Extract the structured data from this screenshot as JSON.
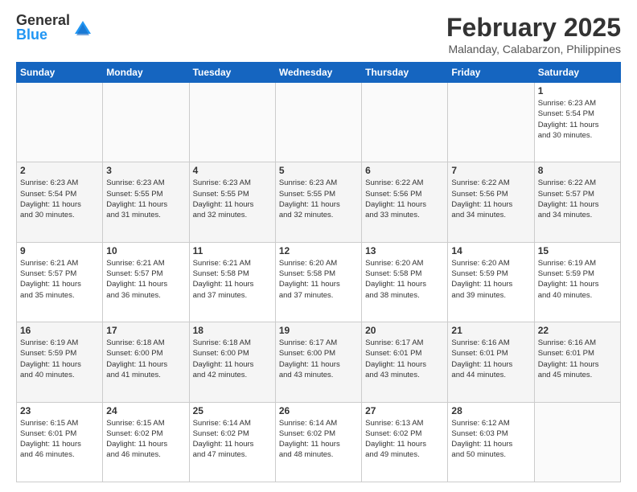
{
  "logo": {
    "general": "General",
    "blue": "Blue"
  },
  "title": {
    "month_year": "February 2025",
    "location": "Malanday, Calabarzon, Philippines"
  },
  "headers": [
    "Sunday",
    "Monday",
    "Tuesday",
    "Wednesday",
    "Thursday",
    "Friday",
    "Saturday"
  ],
  "weeks": [
    [
      {
        "day": "",
        "info": ""
      },
      {
        "day": "",
        "info": ""
      },
      {
        "day": "",
        "info": ""
      },
      {
        "day": "",
        "info": ""
      },
      {
        "day": "",
        "info": ""
      },
      {
        "day": "",
        "info": ""
      },
      {
        "day": "1",
        "info": "Sunrise: 6:23 AM\nSunset: 5:54 PM\nDaylight: 11 hours\nand 30 minutes."
      }
    ],
    [
      {
        "day": "2",
        "info": "Sunrise: 6:23 AM\nSunset: 5:54 PM\nDaylight: 11 hours\nand 30 minutes."
      },
      {
        "day": "3",
        "info": "Sunrise: 6:23 AM\nSunset: 5:55 PM\nDaylight: 11 hours\nand 31 minutes."
      },
      {
        "day": "4",
        "info": "Sunrise: 6:23 AM\nSunset: 5:55 PM\nDaylight: 11 hours\nand 32 minutes."
      },
      {
        "day": "5",
        "info": "Sunrise: 6:23 AM\nSunset: 5:55 PM\nDaylight: 11 hours\nand 32 minutes."
      },
      {
        "day": "6",
        "info": "Sunrise: 6:22 AM\nSunset: 5:56 PM\nDaylight: 11 hours\nand 33 minutes."
      },
      {
        "day": "7",
        "info": "Sunrise: 6:22 AM\nSunset: 5:56 PM\nDaylight: 11 hours\nand 34 minutes."
      },
      {
        "day": "8",
        "info": "Sunrise: 6:22 AM\nSunset: 5:57 PM\nDaylight: 11 hours\nand 34 minutes."
      }
    ],
    [
      {
        "day": "9",
        "info": "Sunrise: 6:21 AM\nSunset: 5:57 PM\nDaylight: 11 hours\nand 35 minutes."
      },
      {
        "day": "10",
        "info": "Sunrise: 6:21 AM\nSunset: 5:57 PM\nDaylight: 11 hours\nand 36 minutes."
      },
      {
        "day": "11",
        "info": "Sunrise: 6:21 AM\nSunset: 5:58 PM\nDaylight: 11 hours\nand 37 minutes."
      },
      {
        "day": "12",
        "info": "Sunrise: 6:20 AM\nSunset: 5:58 PM\nDaylight: 11 hours\nand 37 minutes."
      },
      {
        "day": "13",
        "info": "Sunrise: 6:20 AM\nSunset: 5:58 PM\nDaylight: 11 hours\nand 38 minutes."
      },
      {
        "day": "14",
        "info": "Sunrise: 6:20 AM\nSunset: 5:59 PM\nDaylight: 11 hours\nand 39 minutes."
      },
      {
        "day": "15",
        "info": "Sunrise: 6:19 AM\nSunset: 5:59 PM\nDaylight: 11 hours\nand 40 minutes."
      }
    ],
    [
      {
        "day": "16",
        "info": "Sunrise: 6:19 AM\nSunset: 5:59 PM\nDaylight: 11 hours\nand 40 minutes."
      },
      {
        "day": "17",
        "info": "Sunrise: 6:18 AM\nSunset: 6:00 PM\nDaylight: 11 hours\nand 41 minutes."
      },
      {
        "day": "18",
        "info": "Sunrise: 6:18 AM\nSunset: 6:00 PM\nDaylight: 11 hours\nand 42 minutes."
      },
      {
        "day": "19",
        "info": "Sunrise: 6:17 AM\nSunset: 6:00 PM\nDaylight: 11 hours\nand 43 minutes."
      },
      {
        "day": "20",
        "info": "Sunrise: 6:17 AM\nSunset: 6:01 PM\nDaylight: 11 hours\nand 43 minutes."
      },
      {
        "day": "21",
        "info": "Sunrise: 6:16 AM\nSunset: 6:01 PM\nDaylight: 11 hours\nand 44 minutes."
      },
      {
        "day": "22",
        "info": "Sunrise: 6:16 AM\nSunset: 6:01 PM\nDaylight: 11 hours\nand 45 minutes."
      }
    ],
    [
      {
        "day": "23",
        "info": "Sunrise: 6:15 AM\nSunset: 6:01 PM\nDaylight: 11 hours\nand 46 minutes."
      },
      {
        "day": "24",
        "info": "Sunrise: 6:15 AM\nSunset: 6:02 PM\nDaylight: 11 hours\nand 46 minutes."
      },
      {
        "day": "25",
        "info": "Sunrise: 6:14 AM\nSunset: 6:02 PM\nDaylight: 11 hours\nand 47 minutes."
      },
      {
        "day": "26",
        "info": "Sunrise: 6:14 AM\nSunset: 6:02 PM\nDaylight: 11 hours\nand 48 minutes."
      },
      {
        "day": "27",
        "info": "Sunrise: 6:13 AM\nSunset: 6:02 PM\nDaylight: 11 hours\nand 49 minutes."
      },
      {
        "day": "28",
        "info": "Sunrise: 6:12 AM\nSunset: 6:03 PM\nDaylight: 11 hours\nand 50 minutes."
      },
      {
        "day": "",
        "info": ""
      }
    ]
  ]
}
